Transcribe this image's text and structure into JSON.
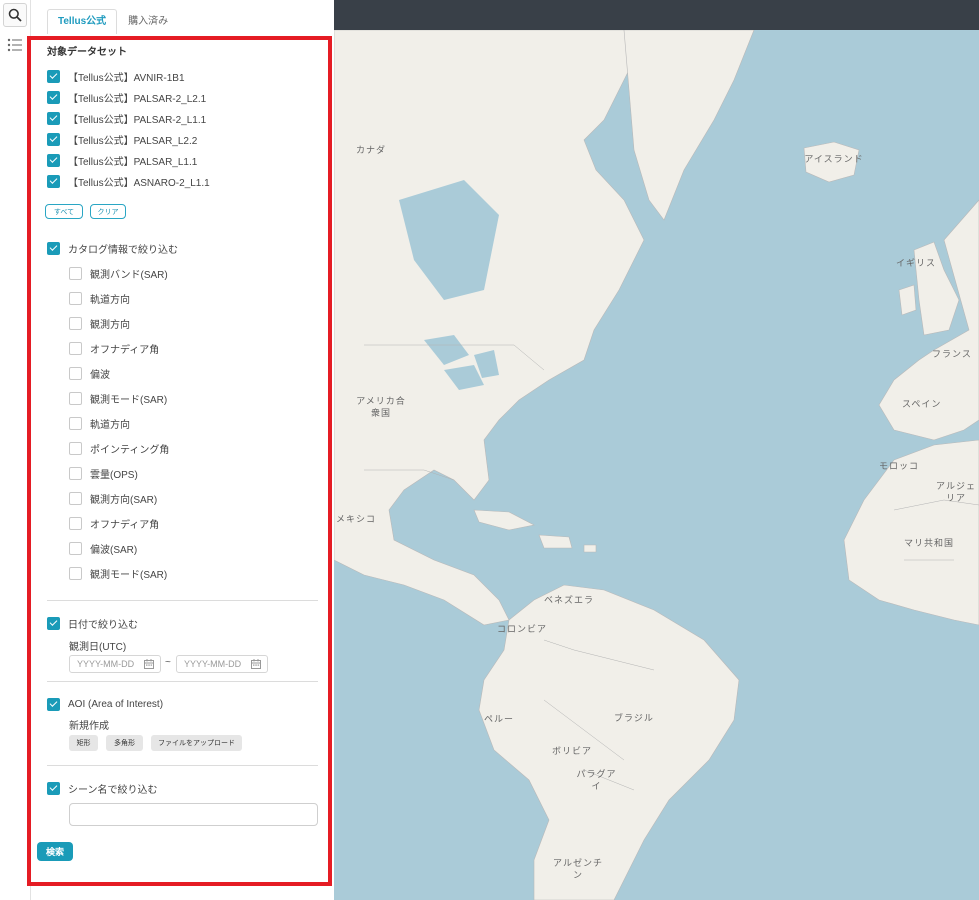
{
  "tabs": [
    {
      "label": "Tellus公式",
      "active": true
    },
    {
      "label": "購入済み",
      "active": false
    }
  ],
  "datasets": {
    "title": "対象データセット",
    "items": [
      {
        "label": "【Tellus公式】AVNIR-1B1",
        "checked": true
      },
      {
        "label": "【Tellus公式】PALSAR-2_L2.1",
        "checked": true
      },
      {
        "label": "【Tellus公式】PALSAR-2_L1.1",
        "checked": true
      },
      {
        "label": "【Tellus公式】PALSAR_L2.2",
        "checked": true
      },
      {
        "label": "【Tellus公式】PALSAR_L1.1",
        "checked": true
      },
      {
        "label": "【Tellus公式】ASNARO-2_L1.1",
        "checked": true
      }
    ],
    "all_label": "すべて",
    "clear_label": "クリア"
  },
  "catalog": {
    "label": "カタログ情報で絞り込む",
    "checked": true,
    "items": [
      {
        "label": "観測バンド(SAR)",
        "checked": false
      },
      {
        "label": "軌道方向",
        "checked": false
      },
      {
        "label": "観測方向",
        "checked": false
      },
      {
        "label": "オフナディア角",
        "checked": false
      },
      {
        "label": "偏波",
        "checked": false
      },
      {
        "label": "観測モード(SAR)",
        "checked": false
      },
      {
        "label": "軌道方向",
        "checked": false
      },
      {
        "label": "ポインティング角",
        "checked": false
      },
      {
        "label": "雲量(OPS)",
        "checked": false
      },
      {
        "label": "観測方向(SAR)",
        "checked": false
      },
      {
        "label": "オフナディア角",
        "checked": false
      },
      {
        "label": "偏波(SAR)",
        "checked": false
      },
      {
        "label": "観測モード(SAR)",
        "checked": false
      }
    ]
  },
  "date_filter": {
    "label": "日付で絞り込む",
    "checked": true,
    "sublabel": "観測日(UTC)",
    "start_placeholder": "YYYY-MM-DD",
    "end_placeholder": "YYYY-MM-DD",
    "separator": "~"
  },
  "aoi": {
    "label": "AOI (Area of Interest)",
    "checked": true,
    "sublabel": "新規作成",
    "buttons": [
      "矩形",
      "多角形",
      "ファイルをアップロード"
    ]
  },
  "scene": {
    "label": "シーン名で絞り込む",
    "checked": true,
    "value": ""
  },
  "search_label": "検索",
  "map": {
    "labels": [
      "カナダ",
      "アイスランド",
      "イギリス",
      "フランス",
      "スペイン",
      "モロッコ",
      "アルジェリア",
      "マリ共和国",
      "アメリカ合衆国",
      "メキシコ",
      "ベネズエラ",
      "コロンビア",
      "ペルー",
      "ブラジル",
      "ボリビア",
      "パラグアイ",
      "アルゼンチン"
    ],
    "land_color": "#f1efe9",
    "water_color": "#aacbd8",
    "accent_color": "#1a9bb8",
    "highlight_color": "#e51c24"
  }
}
